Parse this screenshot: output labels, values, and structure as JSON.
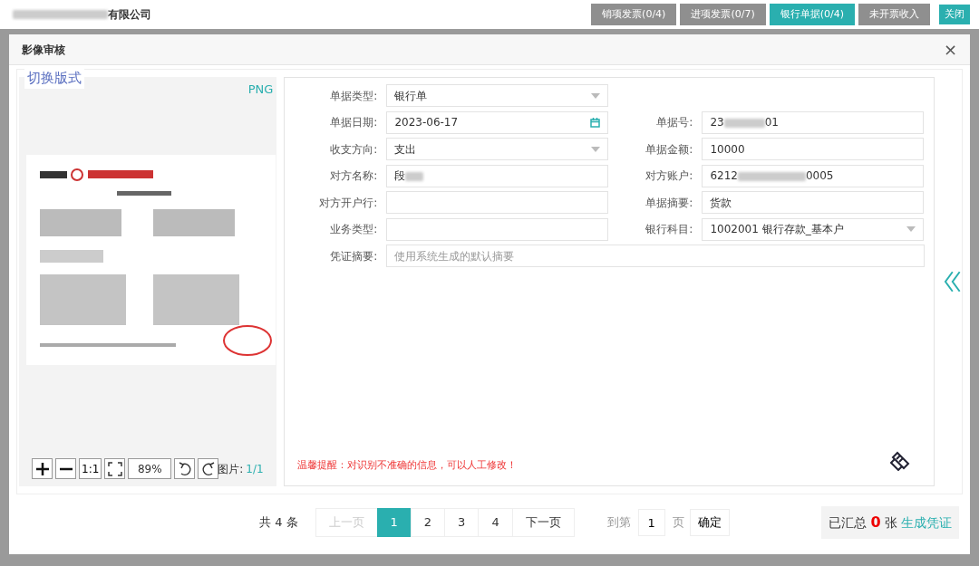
{
  "topbar": {
    "company": "有限公司",
    "tabs": [
      {
        "label": "销项发票(0/4)",
        "selected": false
      },
      {
        "label": "进项发票(0/7)",
        "selected": false
      },
      {
        "label": "银行单据(0/4)",
        "selected": true
      },
      {
        "label": "未开票收入",
        "selected": false
      }
    ],
    "close": "关闭"
  },
  "modal": {
    "title": "影像审核",
    "close": "×"
  },
  "preview": {
    "switch_label": "切换版式",
    "format": "PNG",
    "ratio": "1:1",
    "zoom": "89%",
    "page_label": "图片:",
    "page": "1/1"
  },
  "form": {
    "rows": [
      [
        {
          "label": "单据类型:",
          "kind": "select",
          "value": "银行单"
        }
      ],
      [
        {
          "label": "单据日期:",
          "kind": "date",
          "value": "2023-06-17"
        },
        {
          "label": "单据号:",
          "kind": "text",
          "value_parts": [
            "23",
            "01"
          ]
        }
      ],
      [
        {
          "label": "收支方向:",
          "kind": "select",
          "value": "支出"
        },
        {
          "label": "单据金额:",
          "kind": "text",
          "value": "10000"
        }
      ],
      [
        {
          "label": "对方名称:",
          "kind": "text",
          "value_parts": [
            "段"
          ]
        },
        {
          "label": "对方账户:",
          "kind": "text",
          "value_parts": [
            "6212",
            "0005"
          ]
        }
      ],
      [
        {
          "label": "对方开户行:",
          "kind": "text"
        },
        {
          "label": "单据摘要:",
          "kind": "text",
          "value": "货款"
        }
      ],
      [
        {
          "label": "业务类型:",
          "kind": "text"
        },
        {
          "label": "银行科目:",
          "kind": "select",
          "value": "1002001 银行存款_基本户"
        }
      ],
      [
        {
          "label": "凭证摘要:",
          "kind": "wide",
          "placeholder": "使用系统生成的默认摘要"
        }
      ]
    ],
    "note": "温馨提醒：对识别不准确的信息，可以人工修改！"
  },
  "pager": {
    "total": "共 4 条",
    "prev": {
      "label": "上一页",
      "disabled": true
    },
    "pages": [
      {
        "label": "1",
        "selected": true
      },
      {
        "label": "2",
        "selected": false
      },
      {
        "label": "3",
        "selected": false
      },
      {
        "label": "4",
        "selected": false
      }
    ],
    "next": {
      "label": "下一页",
      "disabled": false
    },
    "goto_label": "到第",
    "goto_value": "1",
    "page_unit": "页",
    "confirm": "确定"
  },
  "summary": {
    "text": "已汇总 **0** 张",
    "action": "生成凭证"
  }
}
